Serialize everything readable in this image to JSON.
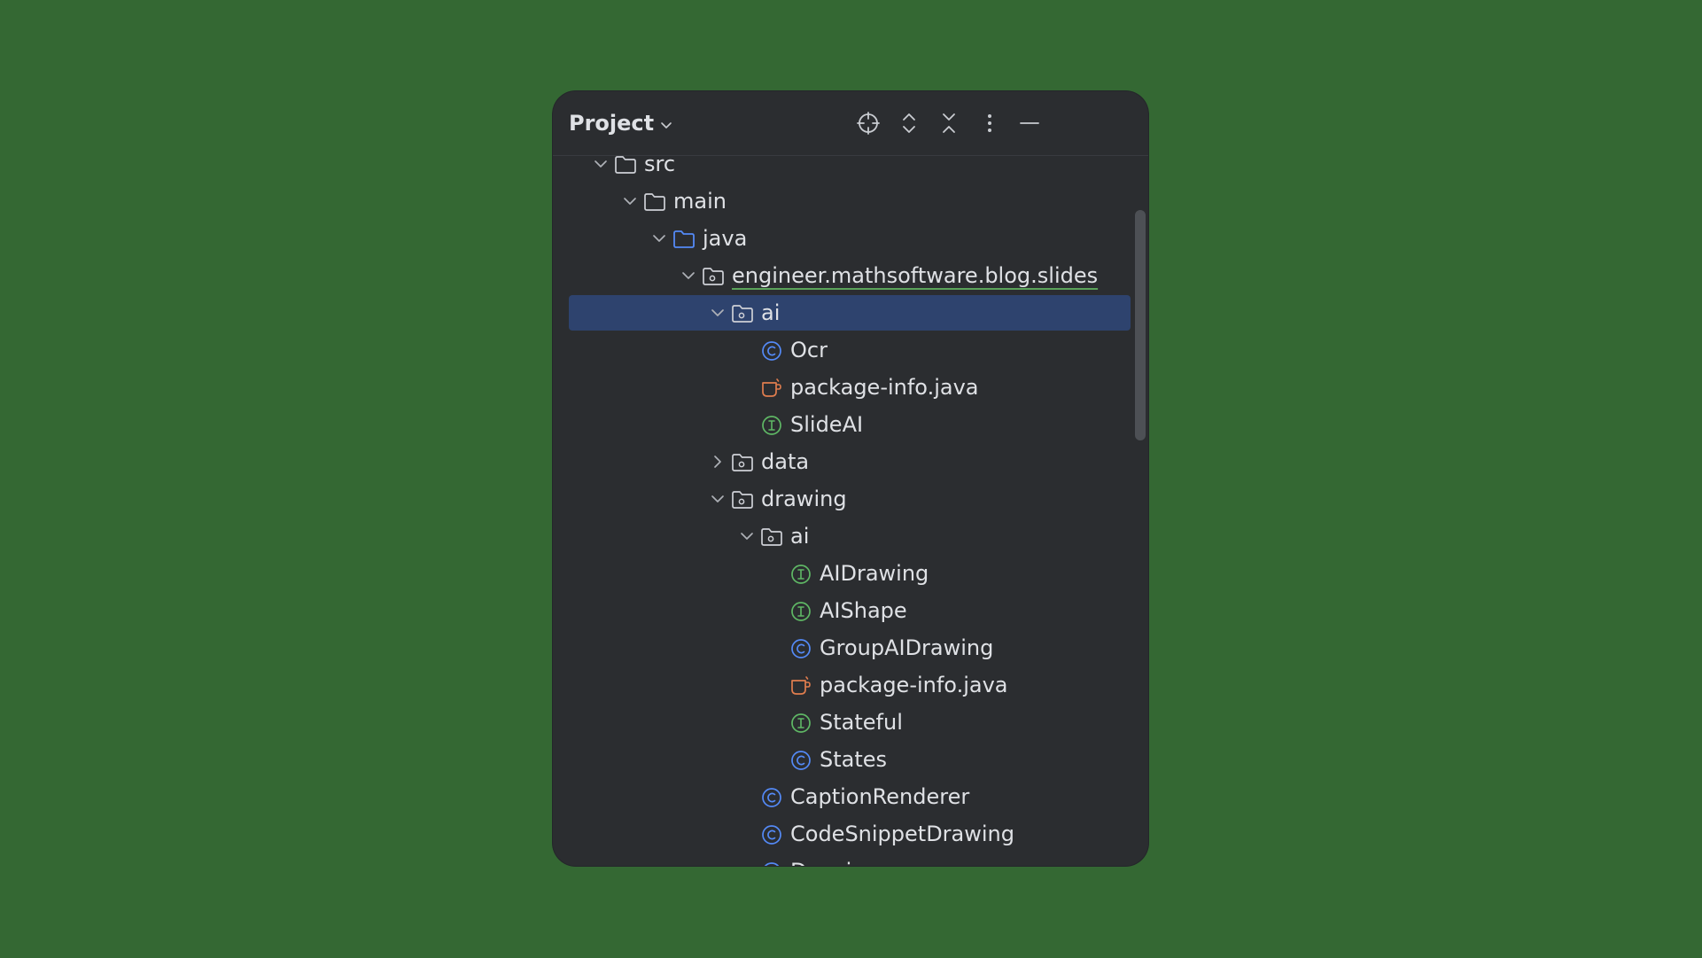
{
  "panel": {
    "title": "Project",
    "toolbar": [
      {
        "name": "locate-icon",
        "label": "Select Opened File"
      },
      {
        "name": "expand-all-icon",
        "label": "Expand All"
      },
      {
        "name": "collapse-all-icon",
        "label": "Collapse All"
      },
      {
        "name": "more-options-icon",
        "label": "Options"
      },
      {
        "name": "minimize-icon",
        "label": "Hide"
      }
    ]
  },
  "colors": {
    "background": "#346833",
    "panel": "#2b2d30",
    "selection": "#2e436e",
    "class_icon": "#548af7",
    "interface_icon": "#5fb865",
    "java_file_icon": "#e07d4e",
    "source_folder_icon": "#548af7"
  },
  "tree": [
    {
      "label": "src",
      "depth": 0,
      "expanded": true,
      "icon": "folder-icon"
    },
    {
      "label": "main",
      "depth": 1,
      "expanded": true,
      "icon": "folder-icon"
    },
    {
      "label": "java",
      "depth": 2,
      "expanded": true,
      "icon": "source-folder-icon"
    },
    {
      "label": "engineer.mathsoftware.blog.slides",
      "depth": 3,
      "expanded": true,
      "icon": "package-icon",
      "underlined": true
    },
    {
      "label": "ai",
      "depth": 4,
      "expanded": true,
      "icon": "package-icon",
      "selected": true
    },
    {
      "label": "Ocr",
      "depth": 5,
      "icon": "class-icon"
    },
    {
      "label": "package-info.java",
      "depth": 5,
      "icon": "java-file-icon"
    },
    {
      "label": "SlideAI",
      "depth": 5,
      "icon": "interface-icon"
    },
    {
      "label": "data",
      "depth": 4,
      "expanded": false,
      "icon": "package-icon"
    },
    {
      "label": "drawing",
      "depth": 4,
      "expanded": true,
      "icon": "package-icon"
    },
    {
      "label": "ai",
      "depth": 5,
      "expanded": true,
      "icon": "package-icon"
    },
    {
      "label": "AIDrawing",
      "depth": 6,
      "icon": "interface-icon"
    },
    {
      "label": "AIShape",
      "depth": 6,
      "icon": "interface-icon"
    },
    {
      "label": "GroupAIDrawing",
      "depth": 6,
      "icon": "class-icon"
    },
    {
      "label": "package-info.java",
      "depth": 6,
      "icon": "java-file-icon"
    },
    {
      "label": "Stateful",
      "depth": 6,
      "icon": "interface-icon"
    },
    {
      "label": "States",
      "depth": 6,
      "icon": "class-icon"
    },
    {
      "label": "CaptionRenderer",
      "depth": 5,
      "icon": "class-icon"
    },
    {
      "label": "CodeSnippetDrawing",
      "depth": 5,
      "icon": "class-icon"
    },
    {
      "label": "Drawing",
      "depth": 5,
      "icon": "class-icon"
    }
  ]
}
